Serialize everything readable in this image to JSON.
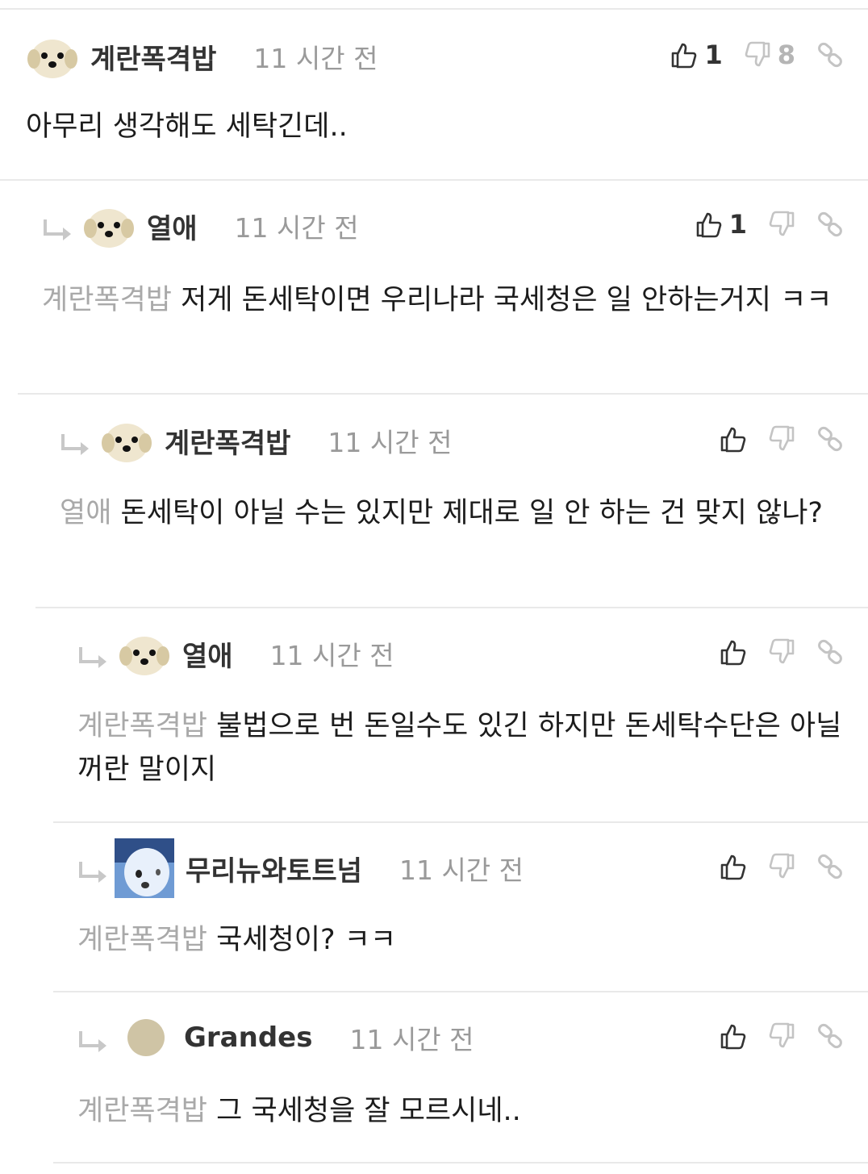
{
  "comments": [
    {
      "author": "계란폭격밥",
      "time": "11 시간 전",
      "likes": "1",
      "dislikes": "8",
      "mention": "",
      "text": "아무리 생각해도 세탁긴데..",
      "avatar": "puppy-face"
    },
    {
      "author": "열애",
      "time": "11 시간 전",
      "likes": "1",
      "dislikes": "",
      "mention": "계란폭격밥",
      "text": "저게 돈세탁이면 우리나라 국세청은 일 안하는거지 ㅋㅋ",
      "avatar": "puppy-face"
    },
    {
      "author": "계란폭격밥",
      "time": "11 시간 전",
      "likes": "",
      "dislikes": "",
      "mention": "열애",
      "text": "돈세탁이 아닐 수는 있지만 제대로 일 안 하는 건 맞지 않나?",
      "avatar": "puppy-face"
    },
    {
      "author": "열애",
      "time": "11 시간 전",
      "likes": "",
      "dislikes": "",
      "mention": "계란폭격밥",
      "text": "불법으로 번 돈일수도 있긴 하지만 돈세탁수단은 아닐꺼란 말이지",
      "avatar": "puppy-face"
    },
    {
      "author": "무리뉴와토트넘",
      "time": "11 시간 전",
      "likes": "",
      "dislikes": "",
      "mention": "계란폭격밥",
      "text": "국세청이? ㅋㅋ",
      "avatar": "white-dog-photo"
    },
    {
      "author": "Grandes",
      "time": "11 시간 전",
      "likes": "",
      "dislikes": "",
      "mention": "계란폭격밥",
      "text": "그 국세청을 잘 모르시네..",
      "avatar": "plain-circle"
    }
  ],
  "icons": {
    "like": "thumbs-up-icon",
    "dislike": "thumbs-down-icon",
    "link": "link-icon",
    "reply": "reply-arrow-icon"
  },
  "colors": {
    "mention": "#a9a9a9",
    "time": "#9a9a9a",
    "divider": "#e9e9e9",
    "icon": "#333333",
    "icon_muted": "#c4c4c4"
  }
}
